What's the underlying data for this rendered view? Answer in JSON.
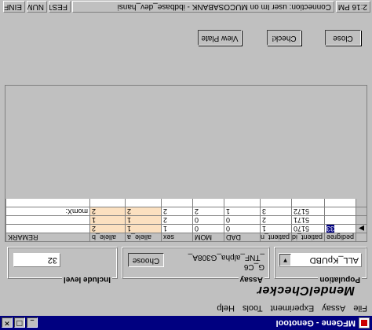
{
  "window": {
    "title": "MFGene - Genotool",
    "minimize_glyph": "_",
    "maximize_glyph": "□",
    "close_glyph": "×"
  },
  "menu": [
    "File",
    "Assay",
    "Experiment",
    "Tools",
    "Help"
  ],
  "panel_title": "MendelChecker",
  "population": {
    "label": "Population",
    "value": "ALL_KpUBD"
  },
  "assay": {
    "label": "Assay",
    "lines": [
      "G_C6",
      "_TNF_alpha_G308A_"
    ],
    "choose_label": "Choose"
  },
  "include_level": {
    "label": "Include level",
    "value": "32"
  },
  "grid": {
    "columns": [
      "pedigree",
      "patient_id",
      "patient_nr",
      "DAD",
      "MOM",
      "sex",
      "allele_a",
      "allele_b",
      "REMARK"
    ],
    "rows": [
      {
        "indicator": "▶",
        "pedigree": "33",
        "patient_id": "5170",
        "patient_nr": "1",
        "dad": "0",
        "mom": "0",
        "sex": "1",
        "allele_a": "1",
        "allele_b": "2",
        "remark": ""
      },
      {
        "indicator": "",
        "pedigree": "",
        "patient_id": "5171",
        "patient_nr": "2",
        "dad": "0",
        "mom": "0",
        "sex": "2",
        "allele_a": "1",
        "allele_b": "1",
        "remark": ""
      },
      {
        "indicator": "",
        "pedigree": "",
        "patient_id": "5172",
        "patient_nr": "3",
        "dad": "1",
        "mom": "2",
        "sex": "2",
        "allele_a": "2",
        "allele_b": "2",
        "remark": "momX:"
      }
    ]
  },
  "buttons": {
    "close": "Close",
    "check": "Check!",
    "view_plate": "View Plate"
  },
  "statusbar": {
    "time": "2:16 PM",
    "connection": "Connection: user Im on MUCOSABANK - ibdbase_dev_hansi",
    "fest": "FEST",
    "num": "NUM",
    "einfg": "EINFG"
  },
  "colors": {
    "titlebar": "#000080",
    "highlight": "#fbe0c0",
    "selection": "#000080"
  }
}
